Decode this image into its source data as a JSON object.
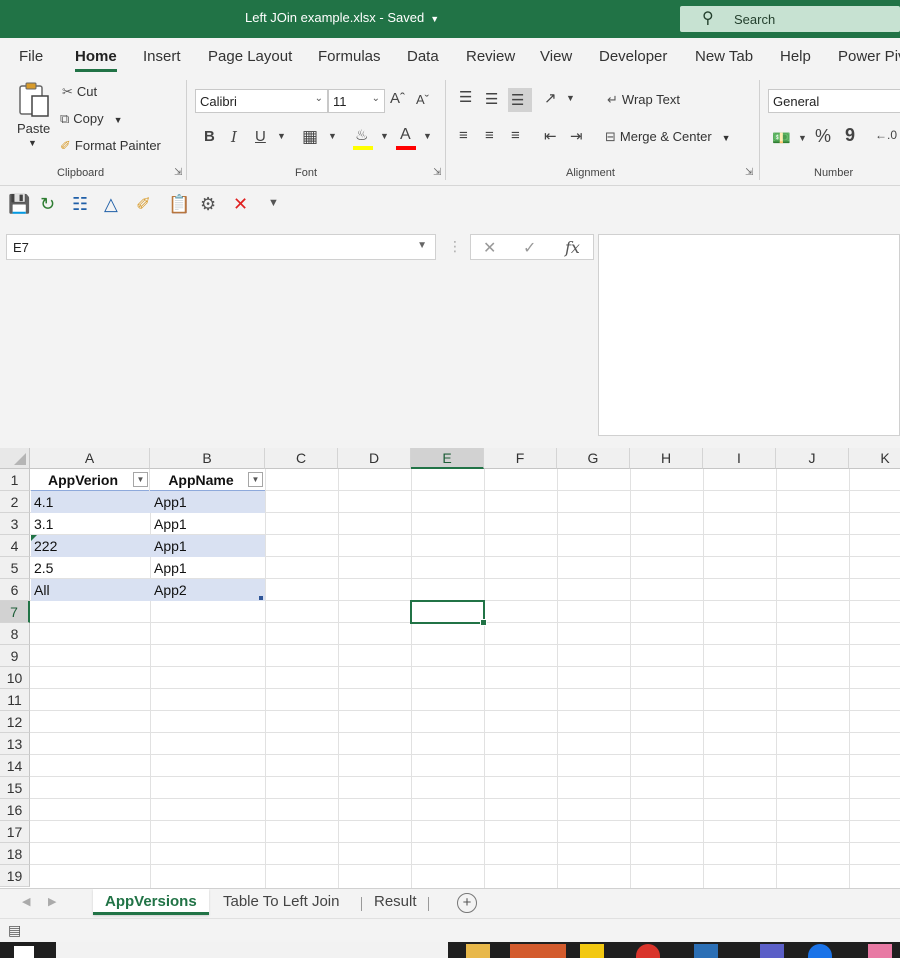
{
  "window": {
    "title": "Left JOin example.xlsx  -  Saved",
    "search_label": "Search"
  },
  "menu_tabs": [
    "File",
    "Home",
    "Insert",
    "Page Layout",
    "Formulas",
    "Data",
    "Review",
    "View",
    "Developer",
    "New Tab",
    "Help",
    "Power Piv"
  ],
  "active_tab": "Home",
  "ribbon": {
    "clipboard": {
      "paste": "Paste",
      "cut": "Cut",
      "copy": "Copy",
      "format_painter": "Format Painter",
      "label": "Clipboard"
    },
    "font": {
      "name": "Calibri",
      "size": "11",
      "bold": "B",
      "italic": "I",
      "underline": "U",
      "label": "Font",
      "highlight_color": "#ffff00",
      "font_color": "#ff0000"
    },
    "alignment": {
      "wrap_text": "Wrap Text",
      "merge_center": "Merge & Center",
      "label": "Alignment"
    },
    "number": {
      "format": "General",
      "label": "Number",
      "percent": "%",
      "comma": "9"
    }
  },
  "formula_bar": {
    "name_box": "E7",
    "formula": ""
  },
  "grid": {
    "columns": [
      "A",
      "B",
      "C",
      "D",
      "E",
      "F",
      "G",
      "H",
      "I",
      "J",
      "K"
    ],
    "rows": [
      "1",
      "2",
      "3",
      "4",
      "5",
      "6",
      "7",
      "8",
      "9",
      "10",
      "11",
      "12",
      "13",
      "14",
      "15",
      "16",
      "17",
      "18",
      "19"
    ],
    "selected_cell": "E7",
    "table": {
      "headers": [
        "AppVerion",
        "AppName"
      ],
      "rows": [
        [
          "4.1",
          "App1"
        ],
        [
          "3.1",
          "App1"
        ],
        [
          "222",
          "App1"
        ],
        [
          "2.5",
          "App1"
        ],
        [
          "All",
          "App2"
        ]
      ]
    }
  },
  "sheets": [
    "AppVersions",
    "Table To Left Join",
    "Result"
  ],
  "active_sheet": "AppVersions",
  "colors": {
    "excel_green": "#217346",
    "table_band": "#d9e1f2"
  }
}
